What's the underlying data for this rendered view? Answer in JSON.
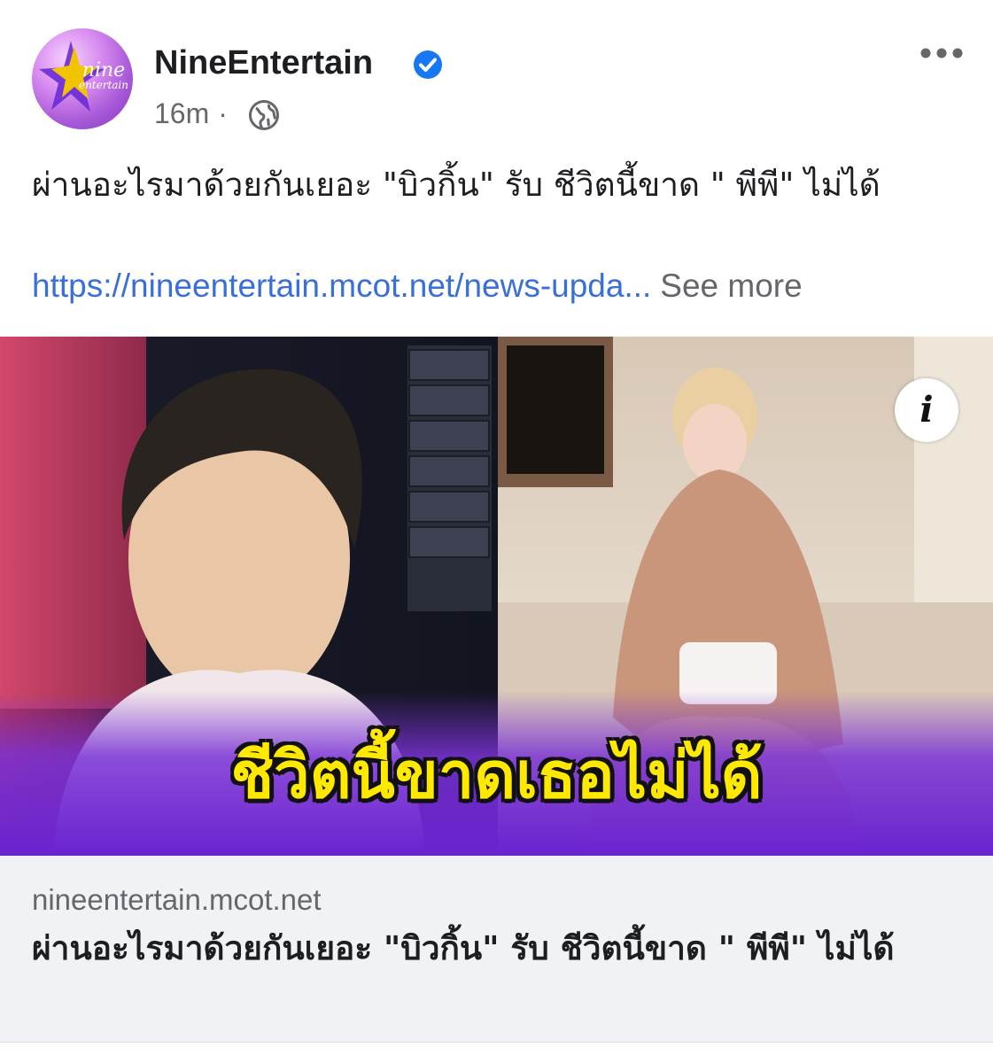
{
  "post": {
    "page_name": "NineEntertain",
    "verified_icon": "verified-badge-icon",
    "time_ago": "16m",
    "separator": "·",
    "audience_icon": "globe-icon",
    "more_icon": "more-options-icon",
    "avatar_logo_line1": "nine",
    "avatar_logo_line2": "entertain",
    "caption": "ผ่านอะไรมาด้วยกันเยอะ \"บิวกิ้น\" รับ ชีวิตนี้ขาด \" พีพี\" ไม่ได้",
    "link_text": "https://nineentertain.mcot.net/news-upda...",
    "see_more": "See more"
  },
  "image": {
    "overlay_text": "ชีวิตนี้ขาดเธอไม่ได้",
    "info_label": "i",
    "colors": {
      "overlay_text": "#ffe900",
      "banner": "#6a23d0"
    }
  },
  "link_card": {
    "domain": "nineentertain.mcot.net",
    "title": "ผ่านอะไรมาด้วยกันเยอะ \"บิวกิ้น\" รับ ชีวิตนี้ขาด \" พีพี\" ไม่ได้"
  },
  "colors": {
    "link": "#3a6fd8",
    "secondary_text": "#65676b",
    "verified": "#1877f2"
  }
}
